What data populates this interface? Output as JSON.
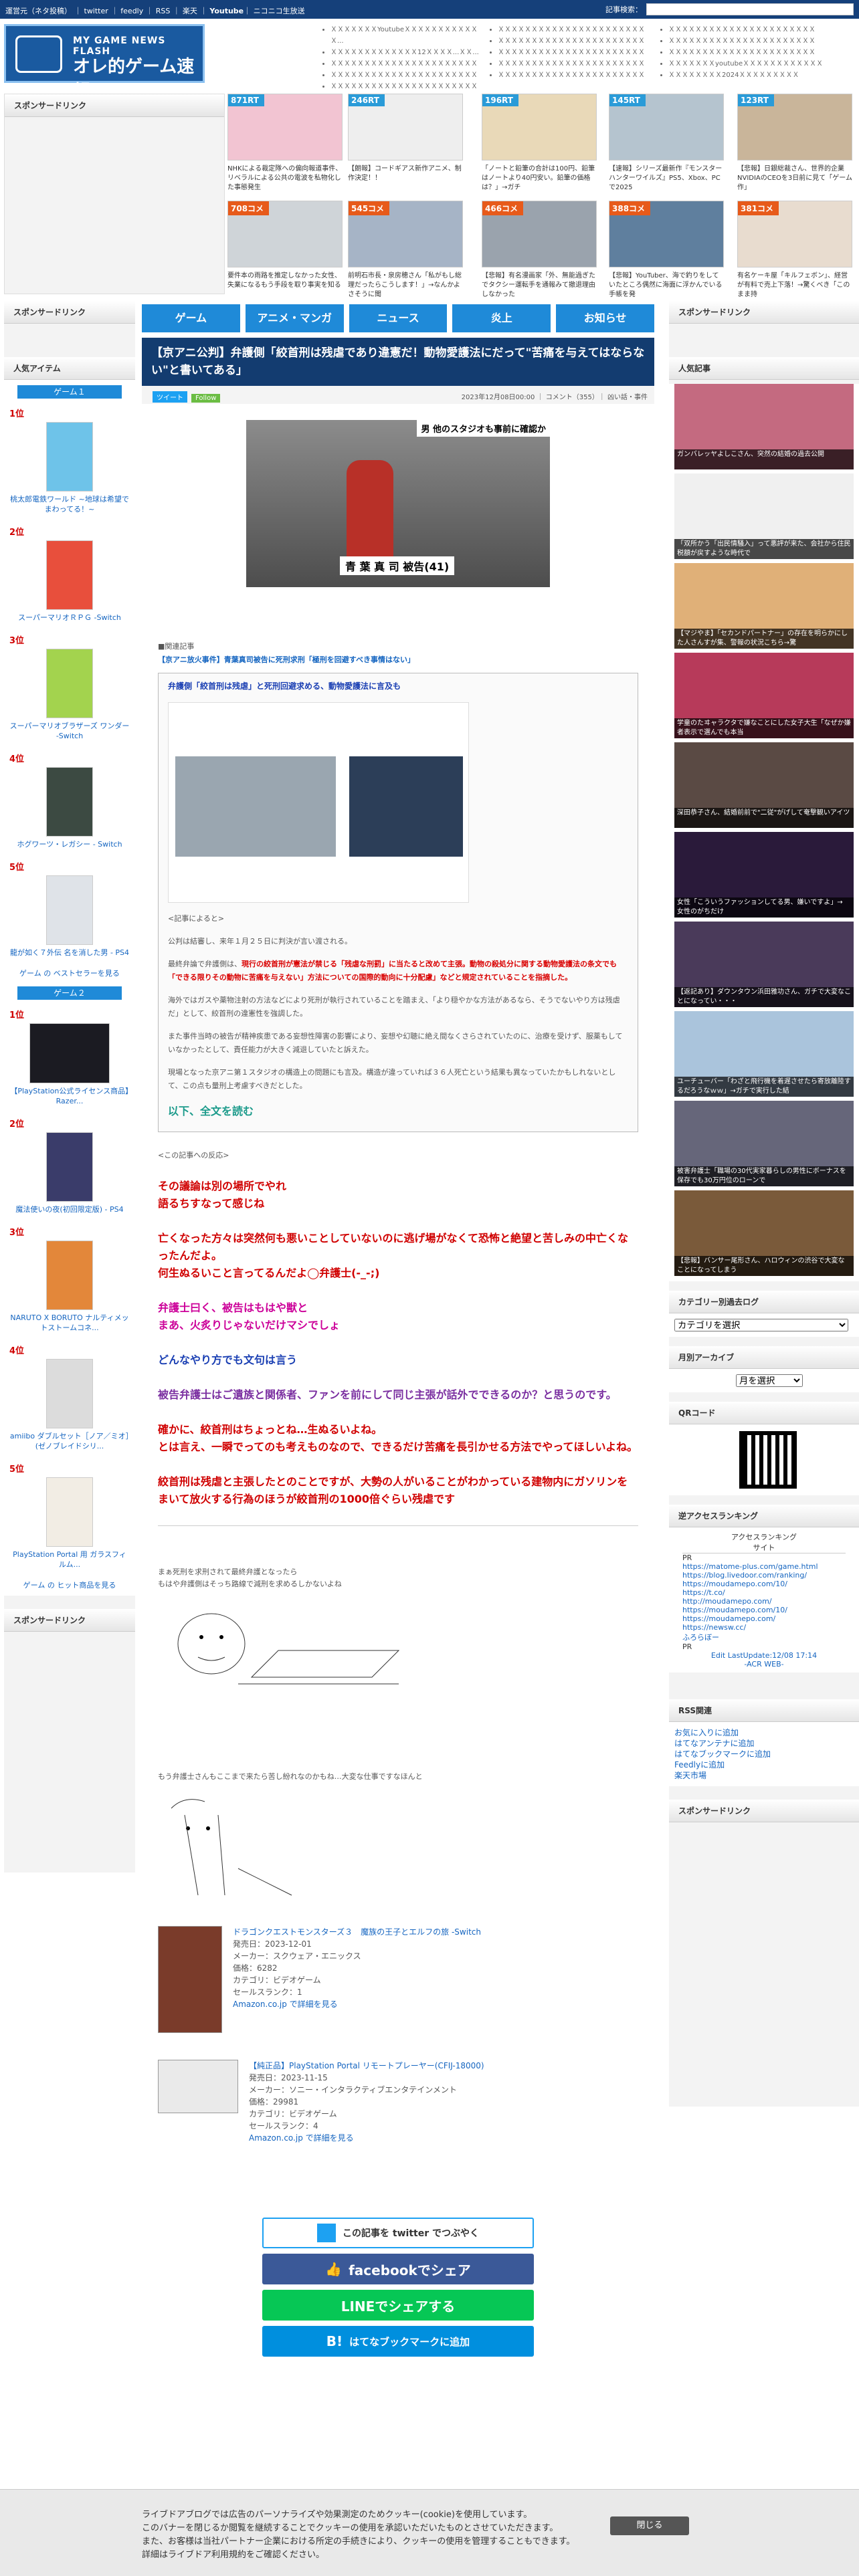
{
  "topbar": {
    "links": [
      "運営元（ネタ投稿）",
      "twitter",
      "feedly",
      "RSS",
      "楽天",
      "Youtube",
      "ニコニコ生放送"
    ],
    "search_label": "記事検索："
  },
  "logo": {
    "line1": "MY GAME NEWS FLASH",
    "line2": "オレ的ゲーム速報@JIN"
  },
  "headnews": {
    "col1": [
      "ＸＸＸＸＸＸＸYoutubeＸＸＸＸＸＸＸＸＸＸＸＸ...",
      "ＸＸＸＸＸＸＸＸＸＸＸＸＸ12ＸＸＸＸ...ＸＸ...",
      "ＸＸＸＸＸＸＸＸＸＸＸＸＸＸＸＸＸＸＸＸＸＸ",
      "ＸＸＸＸＸＸＸＸＸＸＸＸＸＸＸＸＸＸＸＸＸＸ",
      "ＸＸＸＸＸＸＸＸＸＸＸＸＸＸＸＸＸＸＸＸＸＸ"
    ],
    "col2": [
      "ＸＸＸＸＸＸＸＸＸＸＸＸＸＸＸＸＸＸＸＸＸＸ",
      "ＸＸＸＸＸＸＸＸＸＸＸＸＸＸＸＸＸＸＸＸＸＸ",
      "ＸＸＸＸＸＸＸＸＸＸＸＸＸＸＸＸＸＸＸＸＸＸ",
      "ＸＸＸＸＸＸＸＸＸＸＸＸＸＸＸＸＸＸＸＸＸＸ",
      "ＸＸＸＸＸＸＸＸＸＸＸＸＸＸＸＸＸＸＸＸＸＸ"
    ],
    "col3": [
      "ＸＸＸＸＸＸＸＸＸＸＸＸＸＸＸＸＸＸＸＸＸＸ",
      "ＸＸＸＸＸＸＸＸＸＸＸＸＸＸＸＸＸＸＸＸＸＸ",
      "ＸＸＸＸＸＸＸＸＸＸＸＸＸＸＸＸＸＸＸＸＸＸ",
      "ＸＸＸＸＸＸＸyoutubeＸＸＸＸＸＸＸＸＸＸＸＸ",
      "ＸＸＸＸＸＸＸＸ2024ＸＸＸＸＸＸＸＸＸ"
    ]
  },
  "sponsor_label": "スポンサードリンク",
  "thumbs_row1": [
    {
      "badge": "871RT",
      "caption": "NHKによる裁定隊への偏向報道事件、リベラルによる公共の電波を私物化した事態発生"
    },
    {
      "badge": "246RT",
      "caption": "【朗報】コードギアス新作アニメ、制作決定！！"
    },
    {
      "badge": "196RT",
      "caption": "「ノートと鉛筆の合計は100円、鉛筆はノートより40円安い。鉛筆の価格は？」→ガチ"
    },
    {
      "badge": "145RT",
      "caption": "【速報】シリーズ最新作『モンスターハンターワイルズ』PS5、Xbox、PCで2025"
    },
    {
      "badge": "123RT",
      "caption": "【悲報】日銀総裁さん、世界的企業NVIDIAのCEOを3日前に見て「ゲーム作」"
    }
  ],
  "thumbs_row2": [
    {
      "badge": "708コメ",
      "caption": "要件本の雨路を推定しなかった女性、失業になるもう手段を取り事実を知る"
    },
    {
      "badge": "545コメ",
      "caption": "前明石市長・泉房穂さん「私がもし総理だったらこうします！」→なんかよさそうに聞"
    },
    {
      "badge": "466コメ",
      "caption": "【悲報】有名漫画家「外、無能過ぎたでタクシー運転手を通報みて撤退理由しなかった"
    },
    {
      "badge": "388コメ",
      "caption": "【悲報】YouTuber、海で釣りをしていたところ偶然に海面に浮かんでいる手帳を発"
    },
    {
      "badge": "381コメ",
      "caption": "有名ケーキ屋「キルフェボン」、経営が有料で売上下落！→驚くべき「このまま持"
    }
  ],
  "nav": [
    "ゲーム",
    "アニメ・マンガ",
    "ニュース",
    "炎上",
    "お知らせ"
  ],
  "article": {
    "title": "【京アニ公判】弁護側「絞首刑は残虐であり違憲だ！動物愛護法にだって\"苦痛を与えてはならない\"と書いてある」",
    "meta": "2023年12月08日00:00 ｜ コメント（355）｜ 凶い話・事件",
    "tweet": "ツイート",
    "follow": "Follow",
    "pic_caption": "男 他のスタジオも事前に確認か",
    "pic_name": "青 葉 真 司 被告(41)",
    "related_head": "■関連記事",
    "related_link": "【京アニ放火事件】青葉真司被告に死刑求刑「極刑を回避すべき事情はない」",
    "quote_title": "弁護側「絞首刑は残虐」と死刑回避求める、動物愛護法に言及も",
    "quote_intro": "<記事によると>",
    "quote_p1": "公判は結審し、来年１月２５日に判決が言い渡される。",
    "quote_p2a": "最終弁論で弁護側は、",
    "quote_p2b": "現行の絞首刑が憲法が禁じる「残虐な刑罰」に当たると改めて主張。動物の殺処分に関する動物愛護法の条文でも「できる限りその動物に苦痛を与えない」方法についての国際的動向に十分配慮」などと規定されていることを指摘した。",
    "quote_p3": "海外ではガスや薬物注射の方法などにより死刑が執行されていることを踏まえ、「より穏やかな方法があるなら、そうでないやり方は残虐だ」として、絞首刑の違憲性を強調した。",
    "quote_p4": "また事件当時の被告が精神疾患である妄想性障害の影響により、妄想や幻聴に絶え間なくさらされていたのに、治療を受けず、服薬もしていなかったとして、責任能力が大きく減退していたと訴えた。",
    "quote_p5": "現場となった京アニ第１スタジオの構造上の問題にも言及。構造が違っていれば３６人死亡という結果も異なっていたかもしれないとして、この点も量刑上考慮すべきだとした。",
    "read_more": "以下、全文を読む",
    "reaction_head": "<この記事への反応>",
    "comments": [
      {
        "cls": "c-red",
        "text": "その議論は別の場所でやれ\n語るちすなって感じね"
      },
      {
        "cls": "c-red",
        "text": "亡くなった方々は突然何も悪いことしていないのに逃げ場がなくて恐怖と絶望と苦しみの中亡くなったんだよ。\n何生ぬるいこと言ってるんだよ◯弁護士(-_-;)"
      },
      {
        "cls": "c-mag",
        "text": "弁護士曰く、被告はもはや獣と\nまあ、火炙りじゃないだけマシでしょ"
      },
      {
        "cls": "c-blue",
        "text": "どんなやり方でも文句は言う"
      },
      {
        "cls": "c-purple",
        "text": "被告弁護士はご遺族と関係者、ファンを前にして同じ主張が話外でできるのか？と思うのです。"
      },
      {
        "cls": "c-red",
        "text": "確かに、絞首刑はちょっとね…生ぬるいよね。\nとは言え、一瞬でってのも考えものなので、できるだけ苦痛を長引かせる方法でやってほしいよね。"
      },
      {
        "cls": "c-red",
        "text": "絞首刑は残虐と主張したとのことですが、大勢の人がいることがわかっている建物内にガソリンをまいて放火する行為のほうが絞首刑の1000倍ぐらい残虐です"
      }
    ],
    "aa_caption1": "まぁ死刑を求刑されて最終弁護となったら\nもはや弁護側はそっち路線で減刑を求めるしかないよね",
    "aa_caption2": "もう弁護士さんもここまで来たら苦し紛れなのかもね…大変な仕事ですなほんと",
    "products": [
      {
        "title": "ドラゴンクエストモンスターズ３　魔族の王子とエルフの旅 -Switch",
        "lines": [
          "発売日：2023-12-01",
          "メーカー：スクウェア・エニックス",
          "価格：6282",
          "カテゴリ：ビデオゲーム",
          "セールスランク：1"
        ],
        "more": "Amazon.co.jp で詳細を見る"
      },
      {
        "title": "【純正品】PlayStation Portal リモートプレーヤー(CFIJ-18000)",
        "lines": [
          "発売日：2023-11-15",
          "メーカー：ソニー・インタラクティブエンタテインメント",
          "価格：29981",
          "カテゴリ：ビデオゲーム",
          "セールスランク：4"
        ],
        "more": "Amazon.co.jp で詳細を見る"
      }
    ],
    "share": [
      "この記事を twitter でつぶやく",
      "facebookでシェア",
      "LINEでシェアする",
      "はてなブックマークに追加"
    ]
  },
  "left": {
    "popular": "人気アイテム",
    "tab1": "ゲーム１",
    "tab2": "ゲーム２",
    "ranks1": [
      {
        "pos": "1位",
        "name": "桃太郎電鉄ワールド ~地球は希望でまわってる！~"
      },
      {
        "pos": "2位",
        "name": "スーパーマリオＲＰＧ -Switch"
      },
      {
        "pos": "3位",
        "name": "スーパーマリオブラザーズ ワンダー -Switch"
      },
      {
        "pos": "4位",
        "name": "ホグワーツ・レガシー - Switch"
      },
      {
        "pos": "5位",
        "name": "龍が如く７外伝 名を消した男 - PS4"
      }
    ],
    "more1": "ゲーム の ベストセラーを見る",
    "ranks2": [
      {
        "pos": "1位",
        "name": "【PlayStation公式ライセンス商品】Razer..."
      },
      {
        "pos": "2位",
        "name": "魔法使いの夜(初回限定版) - PS4"
      },
      {
        "pos": "3位",
        "name": "NARUTO X BORUTO ナルティメットストームコネ..."
      },
      {
        "pos": "4位",
        "name": "amiibo ダブルセット［ノア／ミオ］(ゼノブレイドシリ..."
      },
      {
        "pos": "5位",
        "name": "PlayStation Portal 用 ガラスフィルム..."
      }
    ],
    "more2": "ゲーム の ヒット商品を見る",
    "sponsor2": "スポンサードリンク"
  },
  "right": {
    "popular": "人気記事",
    "articles": [
      "ガンバレッヤよしこさん、突然の結婚の過去公開",
      "「双所かう「出民情騒入」って悪評が来た、会社から住民税額が戻すような時代で",
      "【マジやま】「セカンドパートナー」の存在を明らかにした人さんすが集、警報の状況こちら→驚",
      "学童のたヰャラクタで嫌なことにした女子大生「なぜか嫌者表示で選んでも本当",
      "深田恭子さん、結婚前前で\"二従\"がげして奄撃観いアイツ",
      "女性「こういうファッションしてる男、嫌いですよ」→ 女性のがちだけ",
      "【返記あり】ダウンタウン浜田雅功さん、ガチで大変なことになってい・・・",
      "ユーチューバー「わざと飛行機を着遅させたら寄放離陸するだろうなｗｗ」→ガチで実行した結",
      "被害弁護士「職場の30代実家暮らしの男性にボーナスを保存でも30万円位のローンで",
      "【悲報】バンサー尾形さん、ハロウィンの渋谷で大変なことになってしまう"
    ],
    "category_head": "カテゴリー別過去ログ",
    "category_select": "カテゴリを選択",
    "archive_head": "月別アーカイブ",
    "archive_select": "月を選択",
    "qr_head": "QRコード",
    "access_head": "逆アクセスランキング",
    "access_title": "アクセスランキング",
    "access_col": "サイト",
    "access_rows": [
      "PR",
      "https://matome-plus.com/game.html",
      "https://blog.livedoor.com/ranking/",
      "https://moudamepo.com/10/",
      "https://t.co/",
      "http://moudamepo.com/",
      "https://moudamepo.com/10/",
      "https://moudamepo.com/",
      "https://newsw.cc/",
      "ふろらぼー",
      "PR"
    ],
    "access_footer": "Edit LastUpdate:12/08 17:14",
    "access_web": "-ACR WEB-",
    "rss_head": "RSS関連",
    "rss_links": [
      "お気に入りに追加",
      "はてなアンテナに追加",
      "はてなブックマークに追加",
      "Feedlyに追加",
      "楽天市場"
    ],
    "sponsor": "スポンサードリンク"
  },
  "cookie": {
    "text": "ライブドアブログでは広告のパーソナライズや効果測定のためクッキー(cookie)を使用しています。\nこのバナーを閉じるか閲覧を継続することでクッキーの使用を承認いただいたものとさせていただきます。\nまた、お客様は当社パートナー企業における所定の手続きにより、クッキーの使用を管理することもできます。\n詳細はライブドア利用規約をご確認ください。",
    "close": "閉じる"
  }
}
